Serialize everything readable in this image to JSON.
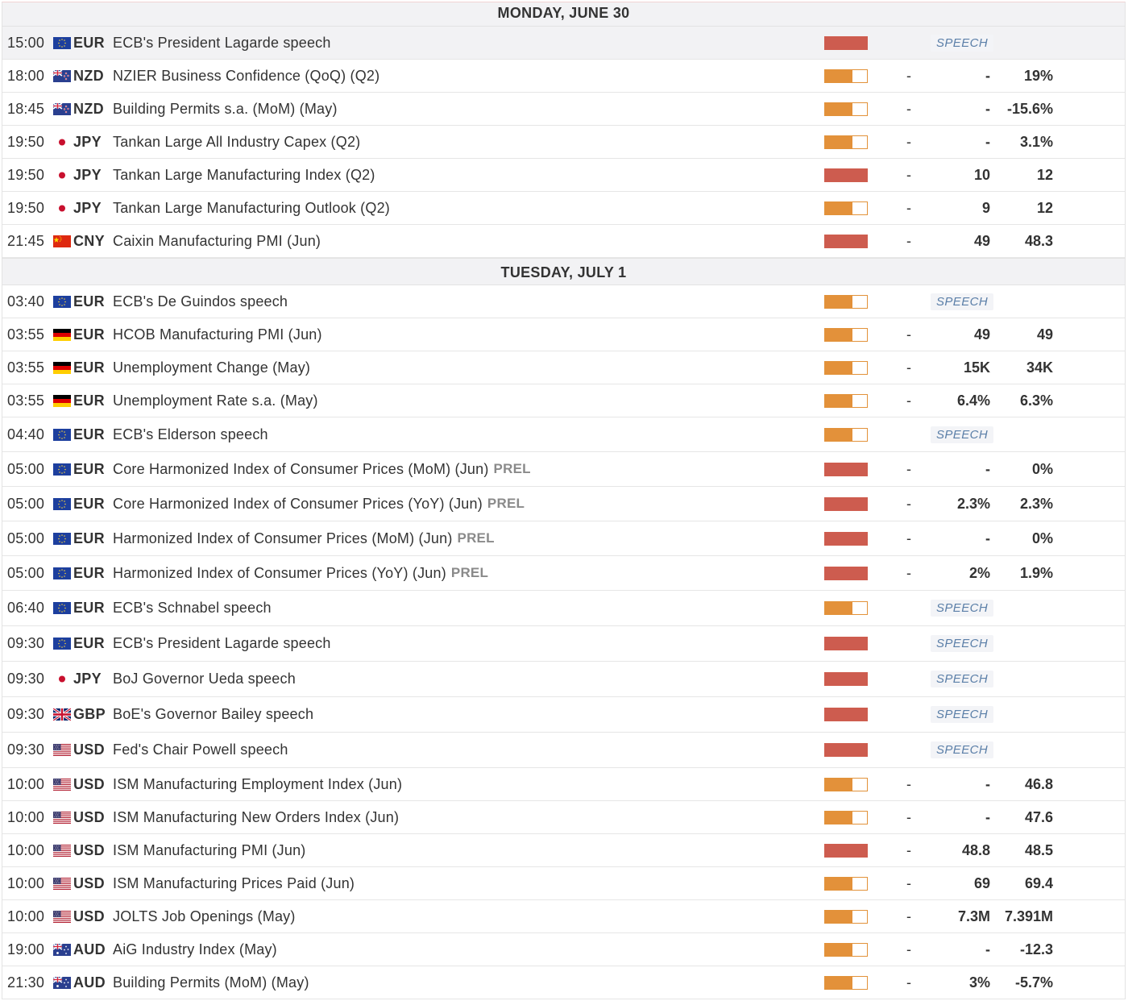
{
  "days": [
    {
      "label": "MONDAY, JUNE 30",
      "rows": [
        {
          "time": "15:00",
          "flag": "eu-flag-icon",
          "currency": "EUR",
          "event": "ECB's President Lagarde speech",
          "prel": "",
          "impact": "high",
          "speech": "SPEECH",
          "actual": "",
          "forecast": "",
          "previous": "",
          "highlight": true
        },
        {
          "time": "18:00",
          "flag": "nz-flag-icon",
          "currency": "NZD",
          "event": "NZIER Business Confidence (QoQ) (Q2)",
          "prel": "",
          "impact": "medium",
          "speech": "",
          "actual": "-",
          "forecast": "-",
          "previous": "19%"
        },
        {
          "time": "18:45",
          "flag": "nz-flag-icon",
          "currency": "NZD",
          "event": "Building Permits s.a. (MoM) (May)",
          "prel": "",
          "impact": "medium",
          "speech": "",
          "actual": "-",
          "forecast": "-",
          "previous": "-15.6%"
        },
        {
          "time": "19:50",
          "flag": "jp-flag-icon",
          "currency": "JPY",
          "event": "Tankan Large All Industry Capex (Q2)",
          "prel": "",
          "impact": "medium",
          "speech": "",
          "actual": "-",
          "forecast": "-",
          "previous": "3.1%"
        },
        {
          "time": "19:50",
          "flag": "jp-flag-icon",
          "currency": "JPY",
          "event": "Tankan Large Manufacturing Index (Q2)",
          "prel": "",
          "impact": "high",
          "speech": "",
          "actual": "-",
          "forecast": "10",
          "previous": "12"
        },
        {
          "time": "19:50",
          "flag": "jp-flag-icon",
          "currency": "JPY",
          "event": "Tankan Large Manufacturing Outlook (Q2)",
          "prel": "",
          "impact": "medium",
          "speech": "",
          "actual": "-",
          "forecast": "9",
          "previous": "12"
        },
        {
          "time": "21:45",
          "flag": "cn-flag-icon",
          "currency": "CNY",
          "event": "Caixin Manufacturing PMI (Jun)",
          "prel": "",
          "impact": "high",
          "speech": "",
          "actual": "-",
          "forecast": "49",
          "previous": "48.3"
        }
      ]
    },
    {
      "label": "TUESDAY, JULY 1",
      "rows": [
        {
          "time": "03:40",
          "flag": "eu-flag-icon",
          "currency": "EUR",
          "event": "ECB's De Guindos speech",
          "prel": "",
          "impact": "medium",
          "speech": "SPEECH",
          "actual": "",
          "forecast": "",
          "previous": ""
        },
        {
          "time": "03:55",
          "flag": "de-flag-icon",
          "currency": "EUR",
          "event": "HCOB Manufacturing PMI (Jun)",
          "prel": "",
          "impact": "medium",
          "speech": "",
          "actual": "-",
          "forecast": "49",
          "previous": "49"
        },
        {
          "time": "03:55",
          "flag": "de-flag-icon",
          "currency": "EUR",
          "event": "Unemployment Change (May)",
          "prel": "",
          "impact": "medium",
          "speech": "",
          "actual": "-",
          "forecast": "15K",
          "previous": "34K"
        },
        {
          "time": "03:55",
          "flag": "de-flag-icon",
          "currency": "EUR",
          "event": "Unemployment Rate s.a. (May)",
          "prel": "",
          "impact": "medium",
          "speech": "",
          "actual": "-",
          "forecast": "6.4%",
          "previous": "6.3%"
        },
        {
          "time": "04:40",
          "flag": "eu-flag-icon",
          "currency": "EUR",
          "event": "ECB's Elderson speech",
          "prel": "",
          "impact": "medium",
          "speech": "SPEECH",
          "actual": "",
          "forecast": "",
          "previous": ""
        },
        {
          "time": "05:00",
          "flag": "eu-flag-icon",
          "currency": "EUR",
          "event": "Core Harmonized Index of Consumer Prices (MoM) (Jun)",
          "prel": "PREL",
          "impact": "high",
          "speech": "",
          "actual": "-",
          "forecast": "-",
          "previous": "0%"
        },
        {
          "time": "05:00",
          "flag": "eu-flag-icon",
          "currency": "EUR",
          "event": "Core Harmonized Index of Consumer Prices (YoY) (Jun)",
          "prel": "PREL",
          "impact": "high",
          "speech": "",
          "actual": "-",
          "forecast": "2.3%",
          "previous": "2.3%"
        },
        {
          "time": "05:00",
          "flag": "eu-flag-icon",
          "currency": "EUR",
          "event": "Harmonized Index of Consumer Prices (MoM) (Jun)",
          "prel": "PREL",
          "impact": "high",
          "speech": "",
          "actual": "-",
          "forecast": "-",
          "previous": "0%"
        },
        {
          "time": "05:00",
          "flag": "eu-flag-icon",
          "currency": "EUR",
          "event": "Harmonized Index of Consumer Prices (YoY) (Jun)",
          "prel": "PREL",
          "impact": "high",
          "speech": "",
          "actual": "-",
          "forecast": "2%",
          "previous": "1.9%"
        },
        {
          "time": "06:40",
          "flag": "eu-flag-icon",
          "currency": "EUR",
          "event": "ECB's Schnabel speech",
          "prel": "",
          "impact": "medium",
          "speech": "SPEECH",
          "actual": "",
          "forecast": "",
          "previous": ""
        },
        {
          "time": "09:30",
          "flag": "eu-flag-icon",
          "currency": "EUR",
          "event": "ECB's President Lagarde speech",
          "prel": "",
          "impact": "high",
          "speech": "SPEECH",
          "actual": "",
          "forecast": "",
          "previous": ""
        },
        {
          "time": "09:30",
          "flag": "jp-flag-icon",
          "currency": "JPY",
          "event": "BoJ Governor Ueda speech",
          "prel": "",
          "impact": "high",
          "speech": "SPEECH",
          "actual": "",
          "forecast": "",
          "previous": ""
        },
        {
          "time": "09:30",
          "flag": "gb-flag-icon",
          "currency": "GBP",
          "event": "BoE's Governor Bailey speech",
          "prel": "",
          "impact": "high",
          "speech": "SPEECH",
          "actual": "",
          "forecast": "",
          "previous": ""
        },
        {
          "time": "09:30",
          "flag": "us-flag-icon",
          "currency": "USD",
          "event": "Fed's Chair Powell speech",
          "prel": "",
          "impact": "high",
          "speech": "SPEECH",
          "actual": "",
          "forecast": "",
          "previous": ""
        },
        {
          "time": "10:00",
          "flag": "us-flag-icon",
          "currency": "USD",
          "event": "ISM Manufacturing Employment Index (Jun)",
          "prel": "",
          "impact": "medium",
          "speech": "",
          "actual": "-",
          "forecast": "-",
          "previous": "46.8"
        },
        {
          "time": "10:00",
          "flag": "us-flag-icon",
          "currency": "USD",
          "event": "ISM Manufacturing New Orders Index (Jun)",
          "prel": "",
          "impact": "medium",
          "speech": "",
          "actual": "-",
          "forecast": "-",
          "previous": "47.6"
        },
        {
          "time": "10:00",
          "flag": "us-flag-icon",
          "currency": "USD",
          "event": "ISM Manufacturing PMI (Jun)",
          "prel": "",
          "impact": "high",
          "speech": "",
          "actual": "-",
          "forecast": "48.8",
          "previous": "48.5"
        },
        {
          "time": "10:00",
          "flag": "us-flag-icon",
          "currency": "USD",
          "event": "ISM Manufacturing Prices Paid (Jun)",
          "prel": "",
          "impact": "medium",
          "speech": "",
          "actual": "-",
          "forecast": "69",
          "previous": "69.4"
        },
        {
          "time": "10:00",
          "flag": "us-flag-icon",
          "currency": "USD",
          "event": "JOLTS Job Openings (May)",
          "prel": "",
          "impact": "medium",
          "speech": "",
          "actual": "-",
          "forecast": "7.3M",
          "previous": "7.391M"
        },
        {
          "time": "19:00",
          "flag": "au-flag-icon",
          "currency": "AUD",
          "event": "AiG Industry Index (May)",
          "prel": "",
          "impact": "medium",
          "speech": "",
          "actual": "-",
          "forecast": "-",
          "previous": "-12.3"
        },
        {
          "time": "21:30",
          "flag": "au-flag-icon",
          "currency": "AUD",
          "event": "Building Permits (MoM) (May)",
          "prel": "",
          "impact": "medium",
          "speech": "",
          "actual": "-",
          "forecast": "3%",
          "previous": "-5.7%"
        }
      ]
    }
  ]
}
